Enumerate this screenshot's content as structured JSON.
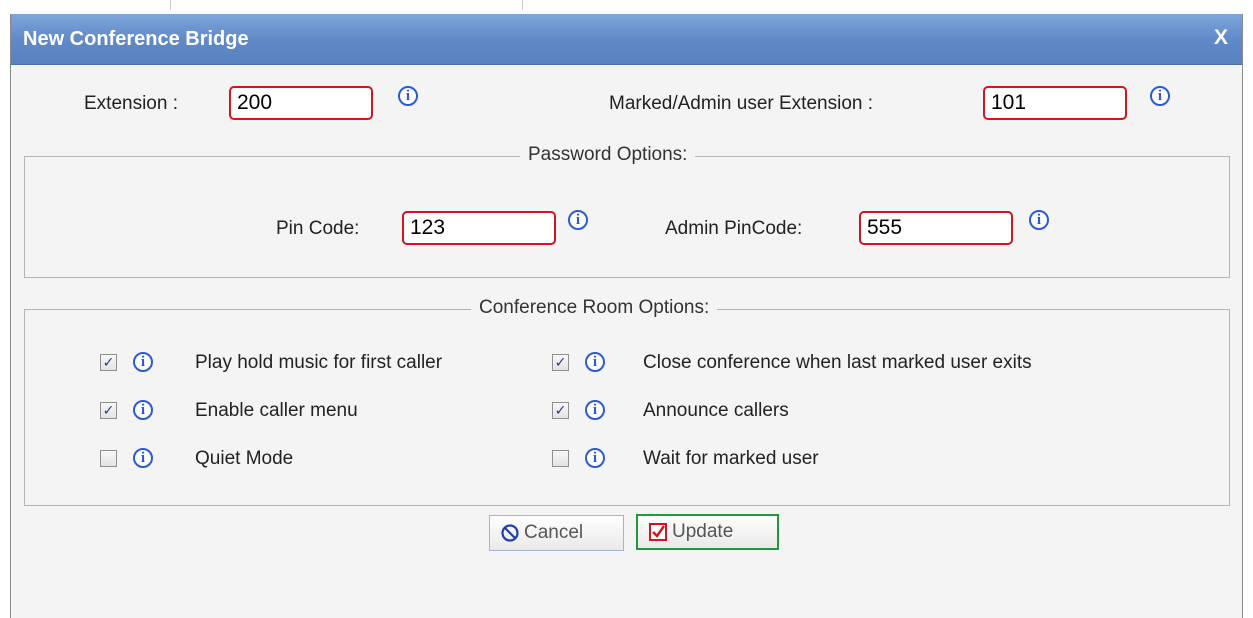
{
  "dialog": {
    "title": "New Conference Bridge",
    "close_label": "X"
  },
  "extension": {
    "label": "Extension :",
    "value": "200"
  },
  "admin_extension": {
    "label": "Marked/Admin user Extension :",
    "value": "101"
  },
  "password_options": {
    "legend": "Password Options:",
    "pin_label": "Pin Code:",
    "pin_value": "123",
    "admin_pin_label": "Admin PinCode:",
    "admin_pin_value": "555"
  },
  "room_options": {
    "legend": "Conference Room Options:",
    "items": [
      {
        "label": "Play hold music for first caller",
        "checked": true
      },
      {
        "label": "Close conference when last marked user exits",
        "checked": true
      },
      {
        "label": "Enable caller menu",
        "checked": true
      },
      {
        "label": "Announce callers",
        "checked": true
      },
      {
        "label": "Quiet Mode",
        "checked": false
      },
      {
        "label": "Wait for marked user",
        "checked": false
      }
    ]
  },
  "buttons": {
    "cancel_label": "Cancel",
    "update_label": "Update"
  },
  "colors": {
    "titlebar": "#6690cd",
    "input_border": "#d4141e",
    "info_icon": "#2a5bd7",
    "update_border": "#1e9a3a"
  },
  "icons": [
    "info-icon",
    "close-icon",
    "cancel-icon",
    "checkbox-icon"
  ]
}
